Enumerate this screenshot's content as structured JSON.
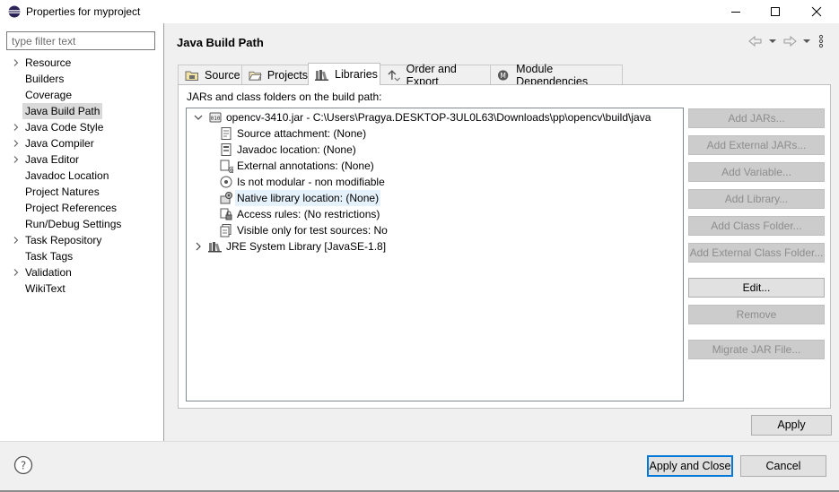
{
  "window": {
    "title": "Properties for myproject",
    "minimize_label": "Minimize",
    "maximize_label": "Maximize",
    "close_label": "Close"
  },
  "sidebar": {
    "filter_placeholder": "type filter text",
    "items": [
      {
        "label": "Resource",
        "expandable": true
      },
      {
        "label": "Builders",
        "expandable": false
      },
      {
        "label": "Coverage",
        "expandable": false
      },
      {
        "label": "Java Build Path",
        "expandable": false,
        "selected": true
      },
      {
        "label": "Java Code Style",
        "expandable": true
      },
      {
        "label": "Java Compiler",
        "expandable": true
      },
      {
        "label": "Java Editor",
        "expandable": true
      },
      {
        "label": "Javadoc Location",
        "expandable": false
      },
      {
        "label": "Project Natures",
        "expandable": false
      },
      {
        "label": "Project References",
        "expandable": false
      },
      {
        "label": "Run/Debug Settings",
        "expandable": false
      },
      {
        "label": "Task Repository",
        "expandable": true
      },
      {
        "label": "Task Tags",
        "expandable": false
      },
      {
        "label": "Validation",
        "expandable": true
      },
      {
        "label": "WikiText",
        "expandable": false
      }
    ]
  },
  "header": {
    "title": "Java Build Path"
  },
  "tabs": [
    {
      "label": "Source",
      "icon": "source-folder-icon",
      "active": false
    },
    {
      "label": "Projects",
      "icon": "projects-folder-icon",
      "active": false
    },
    {
      "label": "Libraries",
      "icon": "libraries-icon",
      "active": true
    },
    {
      "label": "Order and Export",
      "icon": "order-export-icon",
      "active": false
    },
    {
      "label": "Module Dependencies",
      "icon": "module-icon",
      "active": false
    }
  ],
  "libraries": {
    "list_label": "JARs and class folders on the build path:",
    "jar": {
      "label": "opencv-3410.jar - C:\\Users\\Pragya.DESKTOP-3UL0L63\\Downloads\\pp\\opencv\\build\\java",
      "children": [
        {
          "label": "Source attachment: (None)",
          "icon": "source-attachment-icon"
        },
        {
          "label": "Javadoc location: (None)",
          "icon": "javadoc-icon"
        },
        {
          "label": "External annotations: (None)",
          "icon": "annotations-icon"
        },
        {
          "label": "Is not modular - non modifiable",
          "icon": "module-info-icon"
        },
        {
          "label": "Native library location: (None)",
          "icon": "native-library-icon",
          "highlighted": true
        },
        {
          "label": "Access rules: (No restrictions)",
          "icon": "access-rules-icon"
        },
        {
          "label": "Visible only for test sources: No",
          "icon": "test-sources-icon"
        }
      ]
    },
    "jre": {
      "label": "JRE System Library [JavaSE-1.8]"
    }
  },
  "buttons": {
    "add_jars": "Add JARs...",
    "add_external_jars": "Add External JARs...",
    "add_variable": "Add Variable...",
    "add_library": "Add Library...",
    "add_class_folder": "Add Class Folder...",
    "add_external_class_folder": "Add External Class Folder...",
    "edit": "Edit...",
    "remove": "Remove",
    "migrate_jar": "Migrate JAR File..."
  },
  "apply_label": "Apply",
  "footer": {
    "apply_and_close": "Apply and Close",
    "cancel": "Cancel"
  }
}
